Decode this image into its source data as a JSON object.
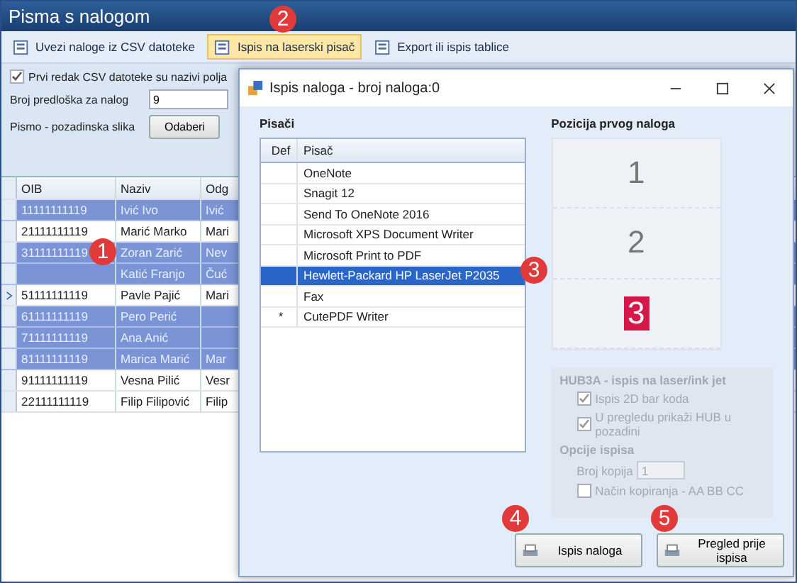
{
  "window": {
    "title": "Pisma s nalogom"
  },
  "toolbar": [
    {
      "label": "Uvezi naloge iz CSV datoteke",
      "selected": false
    },
    {
      "label": "Ispis na laserski pisač",
      "selected": true
    },
    {
      "label": "Export ili ispis tablice",
      "selected": false
    }
  ],
  "options": {
    "first_row_header": {
      "label": "Prvi redak CSV datoteke su nazivi polja",
      "checked": true
    },
    "template": {
      "label": "Broj predloška za nalog",
      "value": "9"
    },
    "background": {
      "label": "Pismo - pozadinska slika",
      "button": "Odaberi"
    }
  },
  "grid": {
    "columns": [
      "OIB",
      "Naziv",
      "Odg"
    ],
    "rows": [
      {
        "oib": "11111111119",
        "naziv": "Ivić Ivo",
        "col3": "Ivić",
        "selected": true,
        "current": false
      },
      {
        "oib": "21111111119",
        "naziv": "Marić Marko",
        "col3": "Mari",
        "selected": false,
        "current": false
      },
      {
        "oib": "31111111119",
        "naziv": "Zoran Zarić",
        "col3": "Nev",
        "selected": true,
        "current": false
      },
      {
        "naziv": "Katić Franjo",
        "col3": "Čuć",
        "selected": true,
        "current": false
      },
      {
        "oib": "51111111119",
        "naziv": "Pavle Pajić",
        "col3": "Mari",
        "selected": false,
        "current": true
      },
      {
        "oib": "61111111119",
        "naziv": "Pero Perić",
        "selected": true,
        "current": false
      },
      {
        "oib": "71111111119",
        "naziv": "Ana Anić",
        "selected": true,
        "current": false
      },
      {
        "oib": "81111111119",
        "naziv": "Marica Marić",
        "col3": "Mar",
        "selected": true,
        "current": false
      },
      {
        "oib": "91111111119",
        "naziv": "Vesna Pilić",
        "col3": "Vesr",
        "selected": false,
        "current": false
      },
      {
        "oib": "22111111119",
        "naziv": "Filip Filipović",
        "col3": "Filip",
        "selected": false,
        "current": false
      }
    ]
  },
  "dialog": {
    "title": "Ispis naloga  - broj naloga:0",
    "printers_label": "Pisači",
    "printer_columns": [
      "Def",
      "Pisač"
    ],
    "printers": [
      {
        "name": "OneNote",
        "selected": false
      },
      {
        "name": "Snagit 12",
        "selected": false
      },
      {
        "name": "Send To OneNote 2016",
        "selected": false
      },
      {
        "name": "Microsoft XPS Document Writer",
        "selected": false
      },
      {
        "name": "Microsoft Print to PDF",
        "selected": false
      },
      {
        "name": "Hewlett-Packard HP LaserJet P2035",
        "selected": true
      },
      {
        "name": "Fax",
        "selected": false
      },
      {
        "def": "*",
        "name": "CutePDF Writer",
        "selected": false
      }
    ],
    "position_label": "Pozicija prvog naloga",
    "positions": [
      {
        "label": "1",
        "selected": false
      },
      {
        "label": "2",
        "selected": false
      },
      {
        "label": "3",
        "selected": true
      }
    ],
    "hub3a": {
      "title": "HUB3A - ispis na laser/ink jet",
      "disabled": true,
      "checks": [
        {
          "label": "Ispis 2D bar koda",
          "checked": true
        },
        {
          "label": "U pregledu prikaži HUB u pozadini",
          "checked": true
        }
      ],
      "options_title": "Opcije ispisa",
      "copies_label": "Broj kopija",
      "copies": "1",
      "collate": {
        "label": "Način kopiranja - AA BB CC",
        "checked": false
      }
    },
    "buttons": [
      "Ispis naloga",
      "Pregled prije ispisa"
    ]
  },
  "callouts": [
    "1",
    "2",
    "3",
    "4",
    "5"
  ]
}
